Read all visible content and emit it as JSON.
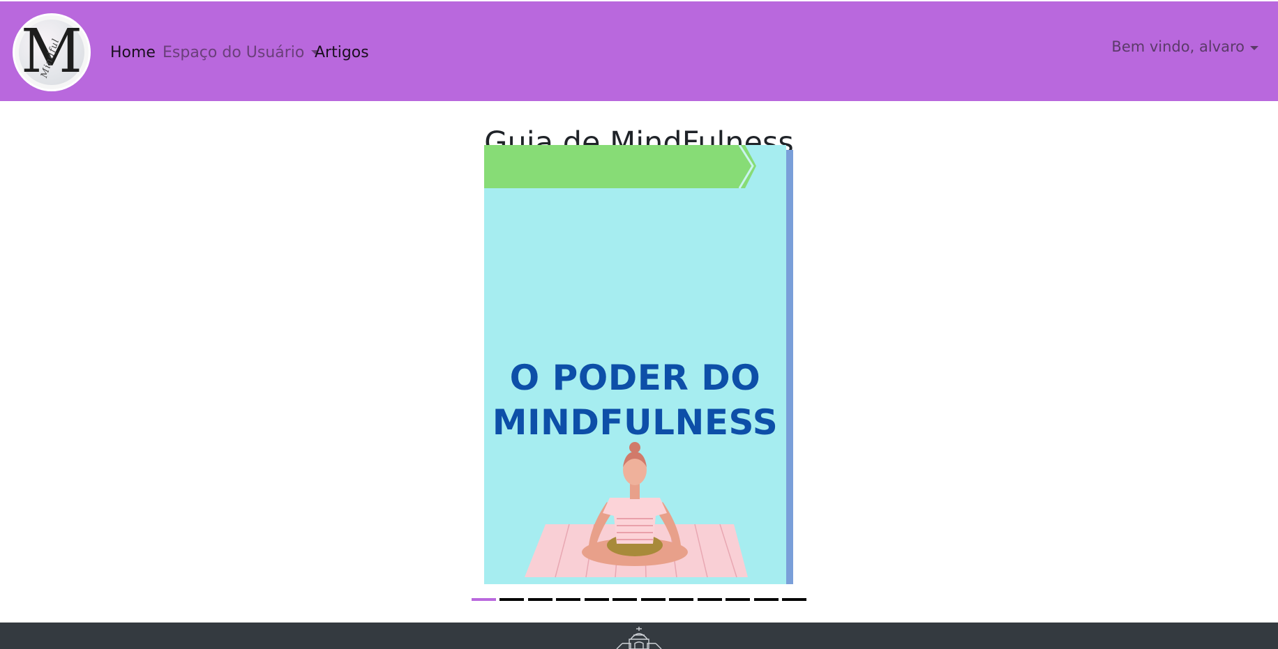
{
  "navbar": {
    "logo_letter": "M",
    "logo_script": "Mindful",
    "links": {
      "home": "Home",
      "user_space": "Espaço do Usuário",
      "articles": "Artigos"
    },
    "welcome": "Bem vindo, alvaro",
    "background_color": "#b968dd"
  },
  "page": {
    "title": "Guia de MindFulness"
  },
  "carousel": {
    "slide": {
      "cover_title_line1": "O PODER DO",
      "cover_title_line2": "MINDFULNESS"
    },
    "indicator_count": 12,
    "active_index": 0,
    "active_color": "#b968dd"
  },
  "footer": {
    "icon": "church-building-icon"
  }
}
